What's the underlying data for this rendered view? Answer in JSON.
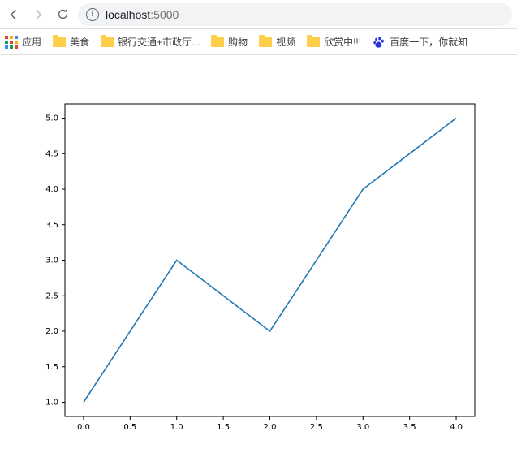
{
  "toolbar": {
    "url": "localhost:5000",
    "url_host": "localhost",
    "url_port": ":5000"
  },
  "bookmarks": {
    "apps_label": "应用",
    "items": [
      {
        "label": "美食"
      },
      {
        "label": "银行交通+市政厅..."
      },
      {
        "label": "购物"
      },
      {
        "label": "视频"
      },
      {
        "label": "欣赏中!!!"
      }
    ],
    "baidu_label": "百度一下，你就知"
  },
  "chart_data": {
    "type": "line",
    "x": [
      0.0,
      1.0,
      2.0,
      3.0,
      4.0
    ],
    "y": [
      1.0,
      3.0,
      2.0,
      4.0,
      5.0
    ],
    "xticks": [
      0.0,
      0.5,
      1.0,
      1.5,
      2.0,
      2.5,
      3.0,
      3.5,
      4.0
    ],
    "yticks": [
      1.0,
      1.5,
      2.0,
      2.5,
      3.0,
      3.5,
      4.0,
      4.5,
      5.0
    ],
    "xlim": [
      -0.2,
      4.2
    ],
    "ylim": [
      0.8,
      5.2
    ],
    "title": "",
    "xlabel": "",
    "ylabel": "",
    "line_color": "#1f77b4"
  }
}
